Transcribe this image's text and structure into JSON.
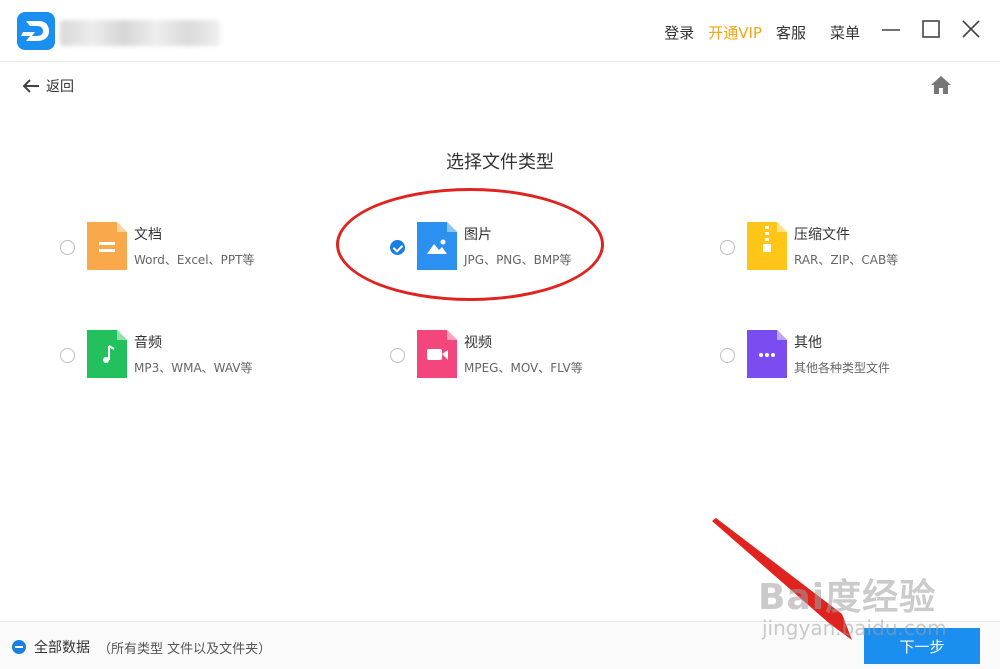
{
  "titlebar": {
    "links": {
      "login": "登录",
      "vip": "开通VIP",
      "service": "客服",
      "menu": "菜单"
    },
    "colors": {
      "vip": "#f3a51b",
      "logo": "#1a8ff0"
    }
  },
  "nav": {
    "back": "返回"
  },
  "page": {
    "title": "选择文件类型"
  },
  "options": [
    {
      "id": "doc",
      "name": "文档",
      "desc": "Word、Excel、PPT等",
      "color": "#f9a94b",
      "icon": "document-icon",
      "checked": false
    },
    {
      "id": "image",
      "name": "图片",
      "desc": "JPG、PNG、BMP等",
      "color": "#2b90f0",
      "icon": "image-icon",
      "checked": true
    },
    {
      "id": "archive",
      "name": "压缩文件",
      "desc": "RAR、ZIP、CAB等",
      "color": "#ffc619",
      "icon": "zip-icon",
      "checked": false
    },
    {
      "id": "audio",
      "name": "音频",
      "desc": "MP3、WMA、WAV等",
      "color": "#22c15e",
      "icon": "music-icon",
      "checked": false
    },
    {
      "id": "video",
      "name": "视频",
      "desc": "MPEG、MOV、FLV等",
      "color": "#f2467c",
      "icon": "video-camera-icon",
      "checked": false
    },
    {
      "id": "other",
      "name": "其他",
      "desc": "其他各种类型文件",
      "color": "#7b4cf0",
      "icon": "more-dots-icon",
      "checked": false
    }
  ],
  "bottom": {
    "all_data": "全部数据",
    "all_data_sub": "（所有类型 文件以及文件夹）",
    "next": "下一步"
  },
  "watermark": {
    "main": "Bai度经验",
    "sub": "jingyan.baidu.com"
  }
}
